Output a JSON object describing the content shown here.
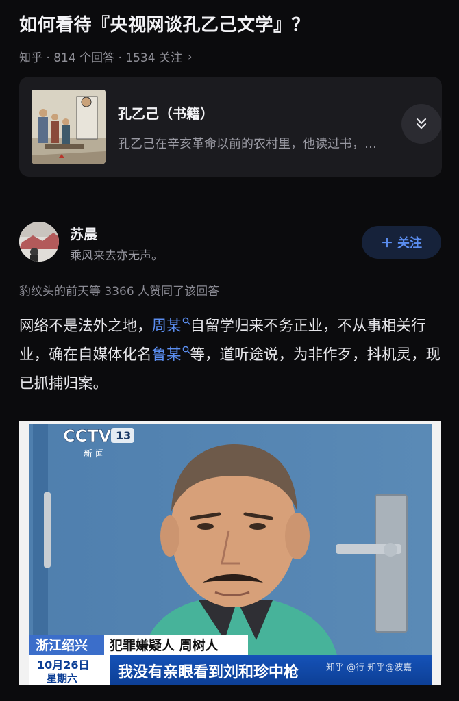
{
  "question": {
    "title": "如何看待『央视网谈孔乙己文学』？",
    "meta": "知乎 · 814 个回答 · 1534 关注"
  },
  "book_card": {
    "name": "孔乙己（书籍）",
    "description": "孔乙己在辛亥革命以前的农村里，他读过书，…"
  },
  "author": {
    "name": "苏晨",
    "bio": "乘风来去亦无声。",
    "follow_label": "关注"
  },
  "votes": "豹纹头的前天等 3366 人赞同了该回答",
  "answer": {
    "p1": "网络不是法外之地，",
    "link1": "周某",
    "p2": "自留学归来不务正业，不从事相关行业，确在自媒体化名",
    "link2": "鲁某",
    "p3": "等，道听途说，为非作歹，抖机灵，现已抓捕归案。"
  },
  "news_image": {
    "channel_logo": "CCTV",
    "channel_number": "13",
    "channel_sub": "新 闻",
    "location": "浙江绍兴",
    "caption_name": "犯罪嫌疑人 周树人",
    "date": "10月26日",
    "weekday": "星期六",
    "quote": "我没有亲眼看到刘和珍中枪",
    "watermark": "知乎 @行 知乎@波嘉"
  },
  "icons": {
    "expand": "chevron-double-down-icon",
    "search_hint": "search-icon",
    "follow_plus": "plus-icon"
  },
  "colors": {
    "background": "#0b0b0d",
    "link": "#5b8ef0",
    "card": "#1b1b1f"
  }
}
